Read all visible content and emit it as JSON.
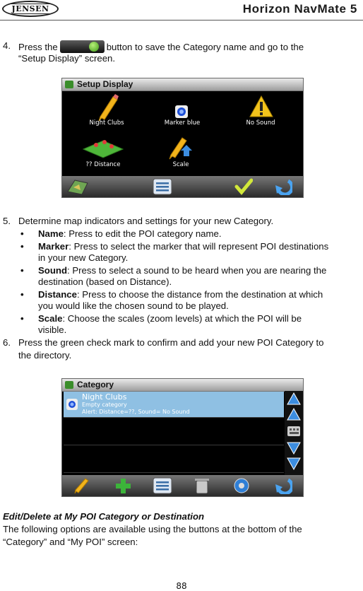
{
  "header": {
    "logo_text": "JENSEN",
    "title": "Horizon NavMate 5"
  },
  "step4": {
    "num": "4.",
    "before": "Press the",
    "after": "button to save the Category name and go to the",
    "line2": "“Setup Display” screen."
  },
  "setup_display": {
    "title": "Setup Display",
    "icons": [
      {
        "label": "Night Clubs",
        "icon": "pencil-icon"
      },
      {
        "label": "Marker blue",
        "icon": "marker-icon"
      },
      {
        "label": "No Sound",
        "icon": "warning-icon"
      },
      {
        "label": "?? Distance",
        "icon": "map-distance-icon"
      },
      {
        "label": "Scale",
        "icon": "scale-icon"
      }
    ],
    "bottom_icons": [
      "map-icon",
      "list-icon",
      "checkmark-icon",
      "back-icon"
    ]
  },
  "step5": {
    "num": "5.",
    "text": "Determine map indicators and settings for your new Category."
  },
  "bullets": [
    {
      "term": "Name",
      "lines": [
        ": Press to edit the POI category name."
      ]
    },
    {
      "term": "Marker",
      "lines": [
        ": Press to select the marker that will represent POI destinations",
        "in your new Category."
      ]
    },
    {
      "term": "Sound",
      "lines": [
        ": Press to select a sound to be heard when you are nearing the",
        "destination (based on Distance)."
      ]
    },
    {
      "term": "Distance",
      "lines": [
        ": Press to choose the distance from the destination at which",
        "you would like the chosen sound to be played."
      ]
    },
    {
      "term": "Scale",
      "lines": [
        ": Choose the scales (zoom levels) at which the POI will be",
        "visible."
      ]
    }
  ],
  "step6": {
    "num": "6.",
    "line1": "Press the green check mark to confirm and add your new POI Category to",
    "line2": "the directory."
  },
  "category_screen": {
    "title": "Category",
    "item_name": "Night Clubs",
    "item_sub1": "Empty category",
    "item_sub2": "Alert: Distance=??,  Sound= No Sound",
    "side_icons": [
      "up-arrow-icon",
      "up-arrow-icon",
      "keyboard-icon",
      "down-arrow-icon",
      "down-arrow-icon"
    ],
    "bottom_icons": [
      "pencil-icon",
      "plus-icon",
      "list-icon",
      "trash-icon",
      "settings-icon",
      "back-icon"
    ]
  },
  "section": {
    "heading": "Edit/Delete at My POI Category or Destination",
    "line1": "The following options are available using the buttons at the bottom of the",
    "line2": "“Category” and “My POI” screen:"
  },
  "footer": {
    "page_number": "88"
  }
}
